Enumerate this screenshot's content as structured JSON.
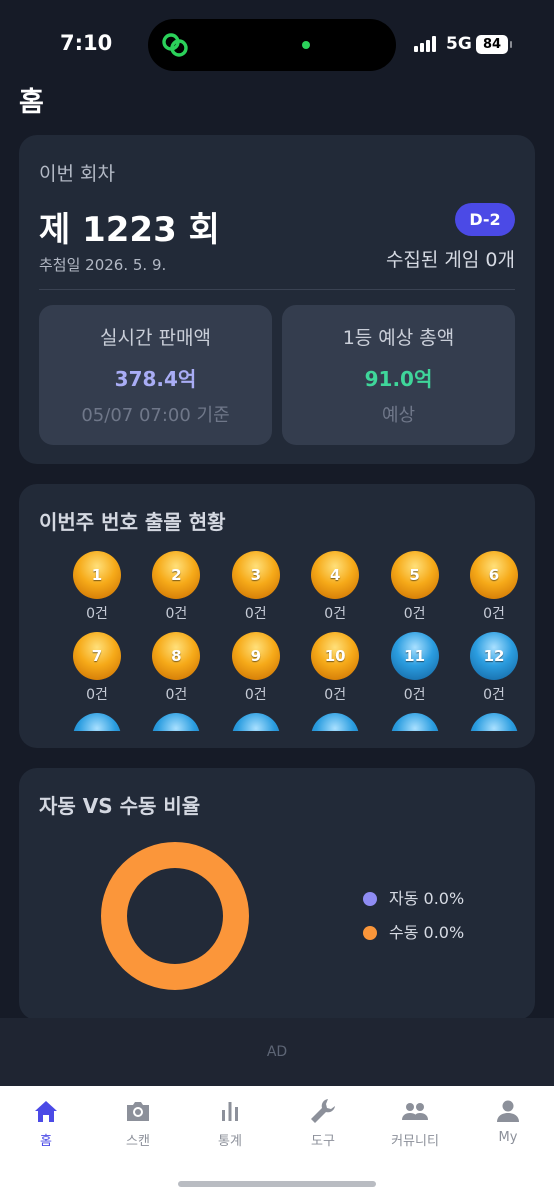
{
  "status_bar": {
    "time": "7:10",
    "network": "5G",
    "battery": "84"
  },
  "header": {
    "title": "홈"
  },
  "round_card": {
    "label": "이번 회차",
    "round": "제 1223 회",
    "draw_date": "추첨일 2026. 5. 9.",
    "dday": "D-2",
    "games_collected": "수집된 게임 0개",
    "sales": {
      "label": "실시간 판매액",
      "value": "378.4억",
      "sub": "05/07 07:00 기준",
      "color": "#a9adf5"
    },
    "first_prize": {
      "label": "1등 예상 총액",
      "value": "91.0억",
      "sub": "예상",
      "color": "#3fd69a"
    }
  },
  "ball_card": {
    "title": "이번주 번호 출몰 현황",
    "balls": [
      {
        "number": "1",
        "count": "0건",
        "color": "gold"
      },
      {
        "number": "2",
        "count": "0건",
        "color": "gold"
      },
      {
        "number": "3",
        "count": "0건",
        "color": "gold"
      },
      {
        "number": "4",
        "count": "0건",
        "color": "gold"
      },
      {
        "number": "5",
        "count": "0건",
        "color": "gold"
      },
      {
        "number": "6",
        "count": "0건",
        "color": "gold"
      },
      {
        "number": "7",
        "count": "0건",
        "color": "gold"
      },
      {
        "number": "8",
        "count": "0건",
        "color": "gold"
      },
      {
        "number": "9",
        "count": "0건",
        "color": "gold"
      },
      {
        "number": "10",
        "count": "0건",
        "color": "gold"
      },
      {
        "number": "11",
        "count": "0건",
        "color": "blue"
      },
      {
        "number": "12",
        "count": "0건",
        "color": "blue"
      },
      {
        "number": "",
        "count": "",
        "color": "blue"
      },
      {
        "number": "",
        "count": "",
        "color": "blue"
      },
      {
        "number": "",
        "count": "",
        "color": "blue"
      },
      {
        "number": "",
        "count": "",
        "color": "blue"
      },
      {
        "number": "",
        "count": "",
        "color": "blue"
      },
      {
        "number": "",
        "count": "",
        "color": "blue"
      }
    ]
  },
  "ratio_card": {
    "title": "자동 VS 수동 비율",
    "ring_color": "#fb963a",
    "legend": [
      {
        "label": "자동 0.0%",
        "color": "#8f8cf3"
      },
      {
        "label": "수동 0.0%",
        "color": "#fb963a"
      }
    ]
  },
  "ad": {
    "label": "AD"
  },
  "tab_bar": {
    "tabs": [
      {
        "key": "home",
        "label": "홈",
        "icon": "home-icon",
        "active": true
      },
      {
        "key": "scan",
        "label": "스캔",
        "icon": "camera-icon",
        "active": false
      },
      {
        "key": "stats",
        "label": "통계",
        "icon": "bar-chart-icon",
        "active": false
      },
      {
        "key": "tools",
        "label": "도구",
        "icon": "wrench-icon",
        "active": false
      },
      {
        "key": "community",
        "label": "커뮤니티",
        "icon": "people-icon",
        "active": false
      },
      {
        "key": "my",
        "label": "My",
        "icon": "person-icon",
        "active": false
      }
    ],
    "active_color": "#4b4ae6",
    "inactive_color": "#8c909a"
  }
}
